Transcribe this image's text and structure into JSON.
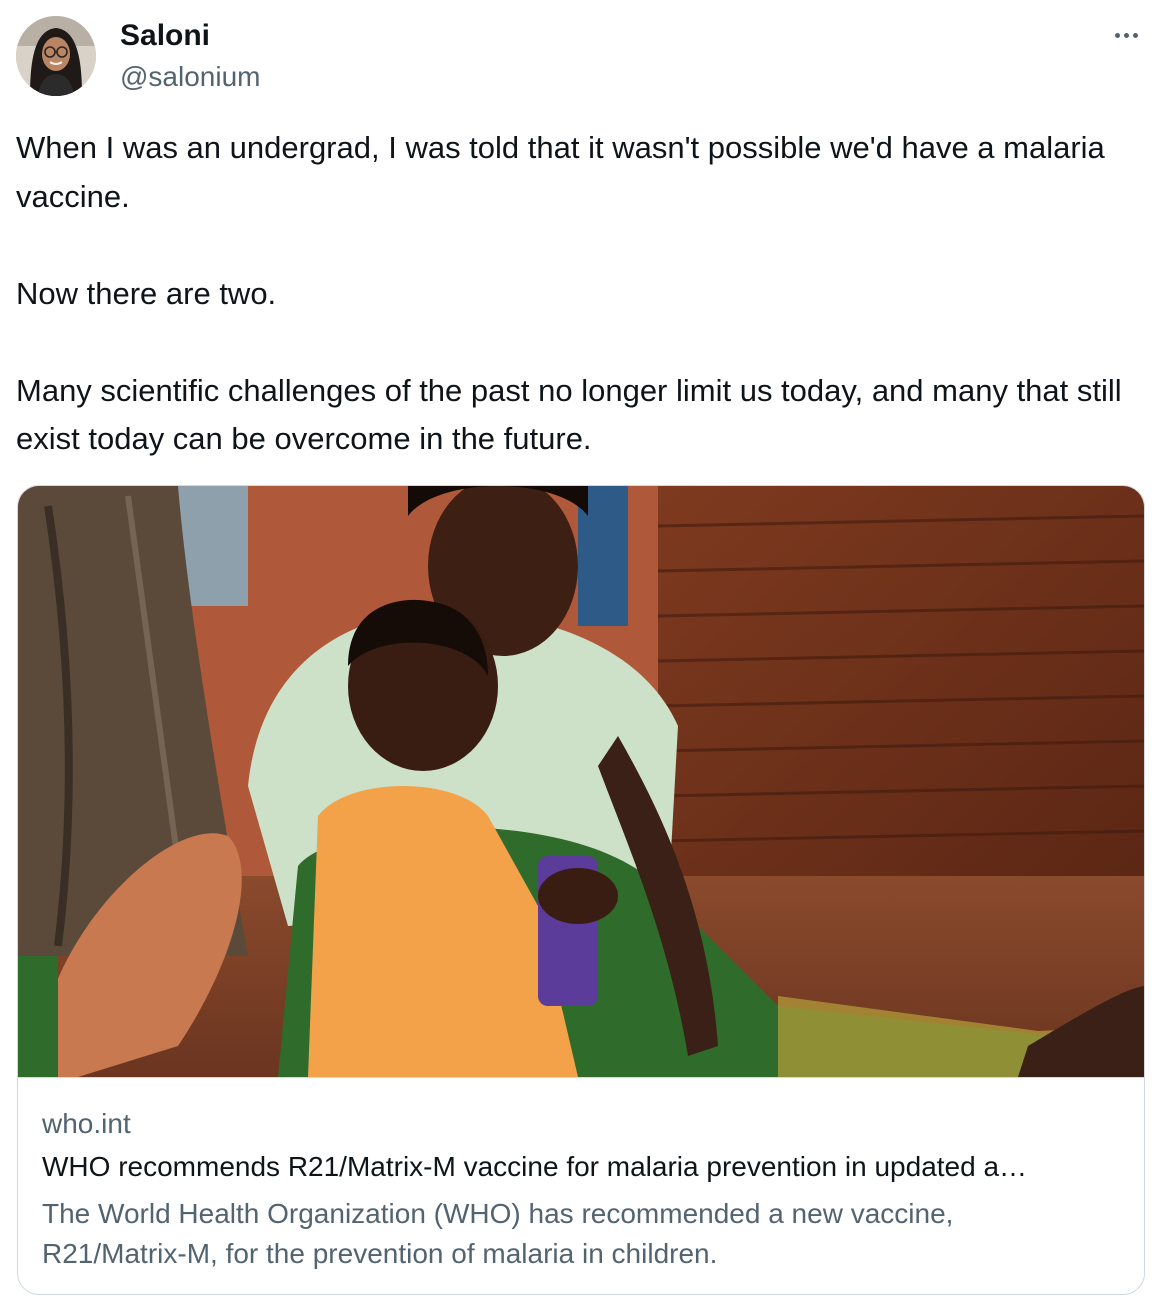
{
  "author": {
    "name": "Saloni",
    "handle": "@salonium"
  },
  "tweet": {
    "paragraphs": [
      "When I was an undergrad, I was told that it wasn't possible we'd have a malaria vaccine.",
      "Now there are two.",
      "Many scientific challenges of the past no longer limit us today, and many that still exist today can be overcome in the future."
    ]
  },
  "card": {
    "domain": "who.int",
    "title": "WHO recommends R21/Matrix-M vaccine for malaria prevention in updated a…",
    "description": "The World Health Organization (WHO) has recommended a new vaccine, R21/Matrix-M, for the prevention of malaria in children."
  },
  "icons": {
    "more": "more-horizontal-icon"
  },
  "colors": {
    "text_primary": "#0f1419",
    "text_secondary": "#536471",
    "border": "#cfd9de"
  }
}
